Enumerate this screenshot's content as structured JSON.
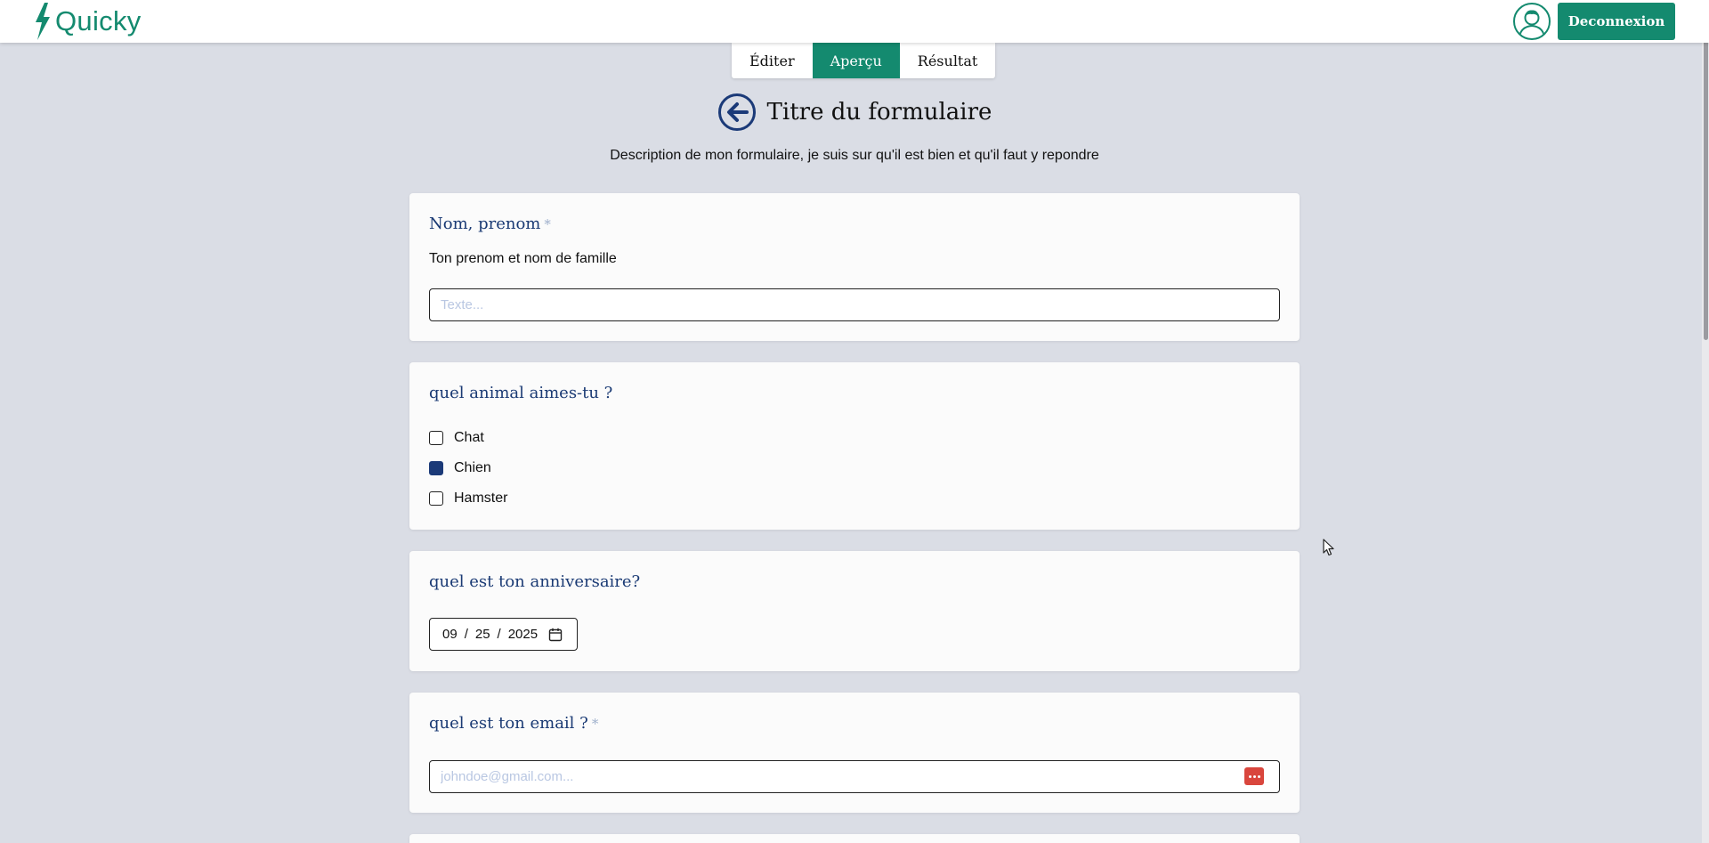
{
  "app": {
    "name": "Quicky",
    "brand_color": "#148a6f",
    "logo_icon": "lightning-bolt-icon"
  },
  "header": {
    "logout_label": "Deconnexion",
    "avatar_icon": "user-avatar-icon"
  },
  "tabs": [
    {
      "label": "Éditer",
      "active": false
    },
    {
      "label": "Aperçu",
      "active": true
    },
    {
      "label": "Résultat",
      "active": false
    }
  ],
  "form": {
    "title": "Titre du formulaire",
    "description": "Description de mon formulaire, je suis sur qu'il est bien et qu'il faut y repondre",
    "back_icon": "arrow-left-circle-icon",
    "questions": [
      {
        "title": "Nom, prenom",
        "required": true,
        "required_mark": "*",
        "description": "Ton prenom et nom de famille",
        "type": "text",
        "placeholder": "Texte..."
      },
      {
        "title": "quel animal aimes-tu ?",
        "required": false,
        "type": "checkbox",
        "options": [
          {
            "label": "Chat",
            "checked": false
          },
          {
            "label": "Chien",
            "checked": true
          },
          {
            "label": "Hamster",
            "checked": false
          }
        ]
      },
      {
        "title": "quel est ton anniversaire?",
        "required": false,
        "type": "date",
        "value": {
          "month": "09",
          "day": "25",
          "year": "2025"
        }
      },
      {
        "title": "quel est ton email ?",
        "required": true,
        "required_mark": "*",
        "type": "email",
        "placeholder": "johndoe@gmail.com..."
      }
    ]
  },
  "colors": {
    "question_title": "#1a3a74",
    "checked_box": "#1b3a78",
    "page_bg": "#dadde5"
  }
}
